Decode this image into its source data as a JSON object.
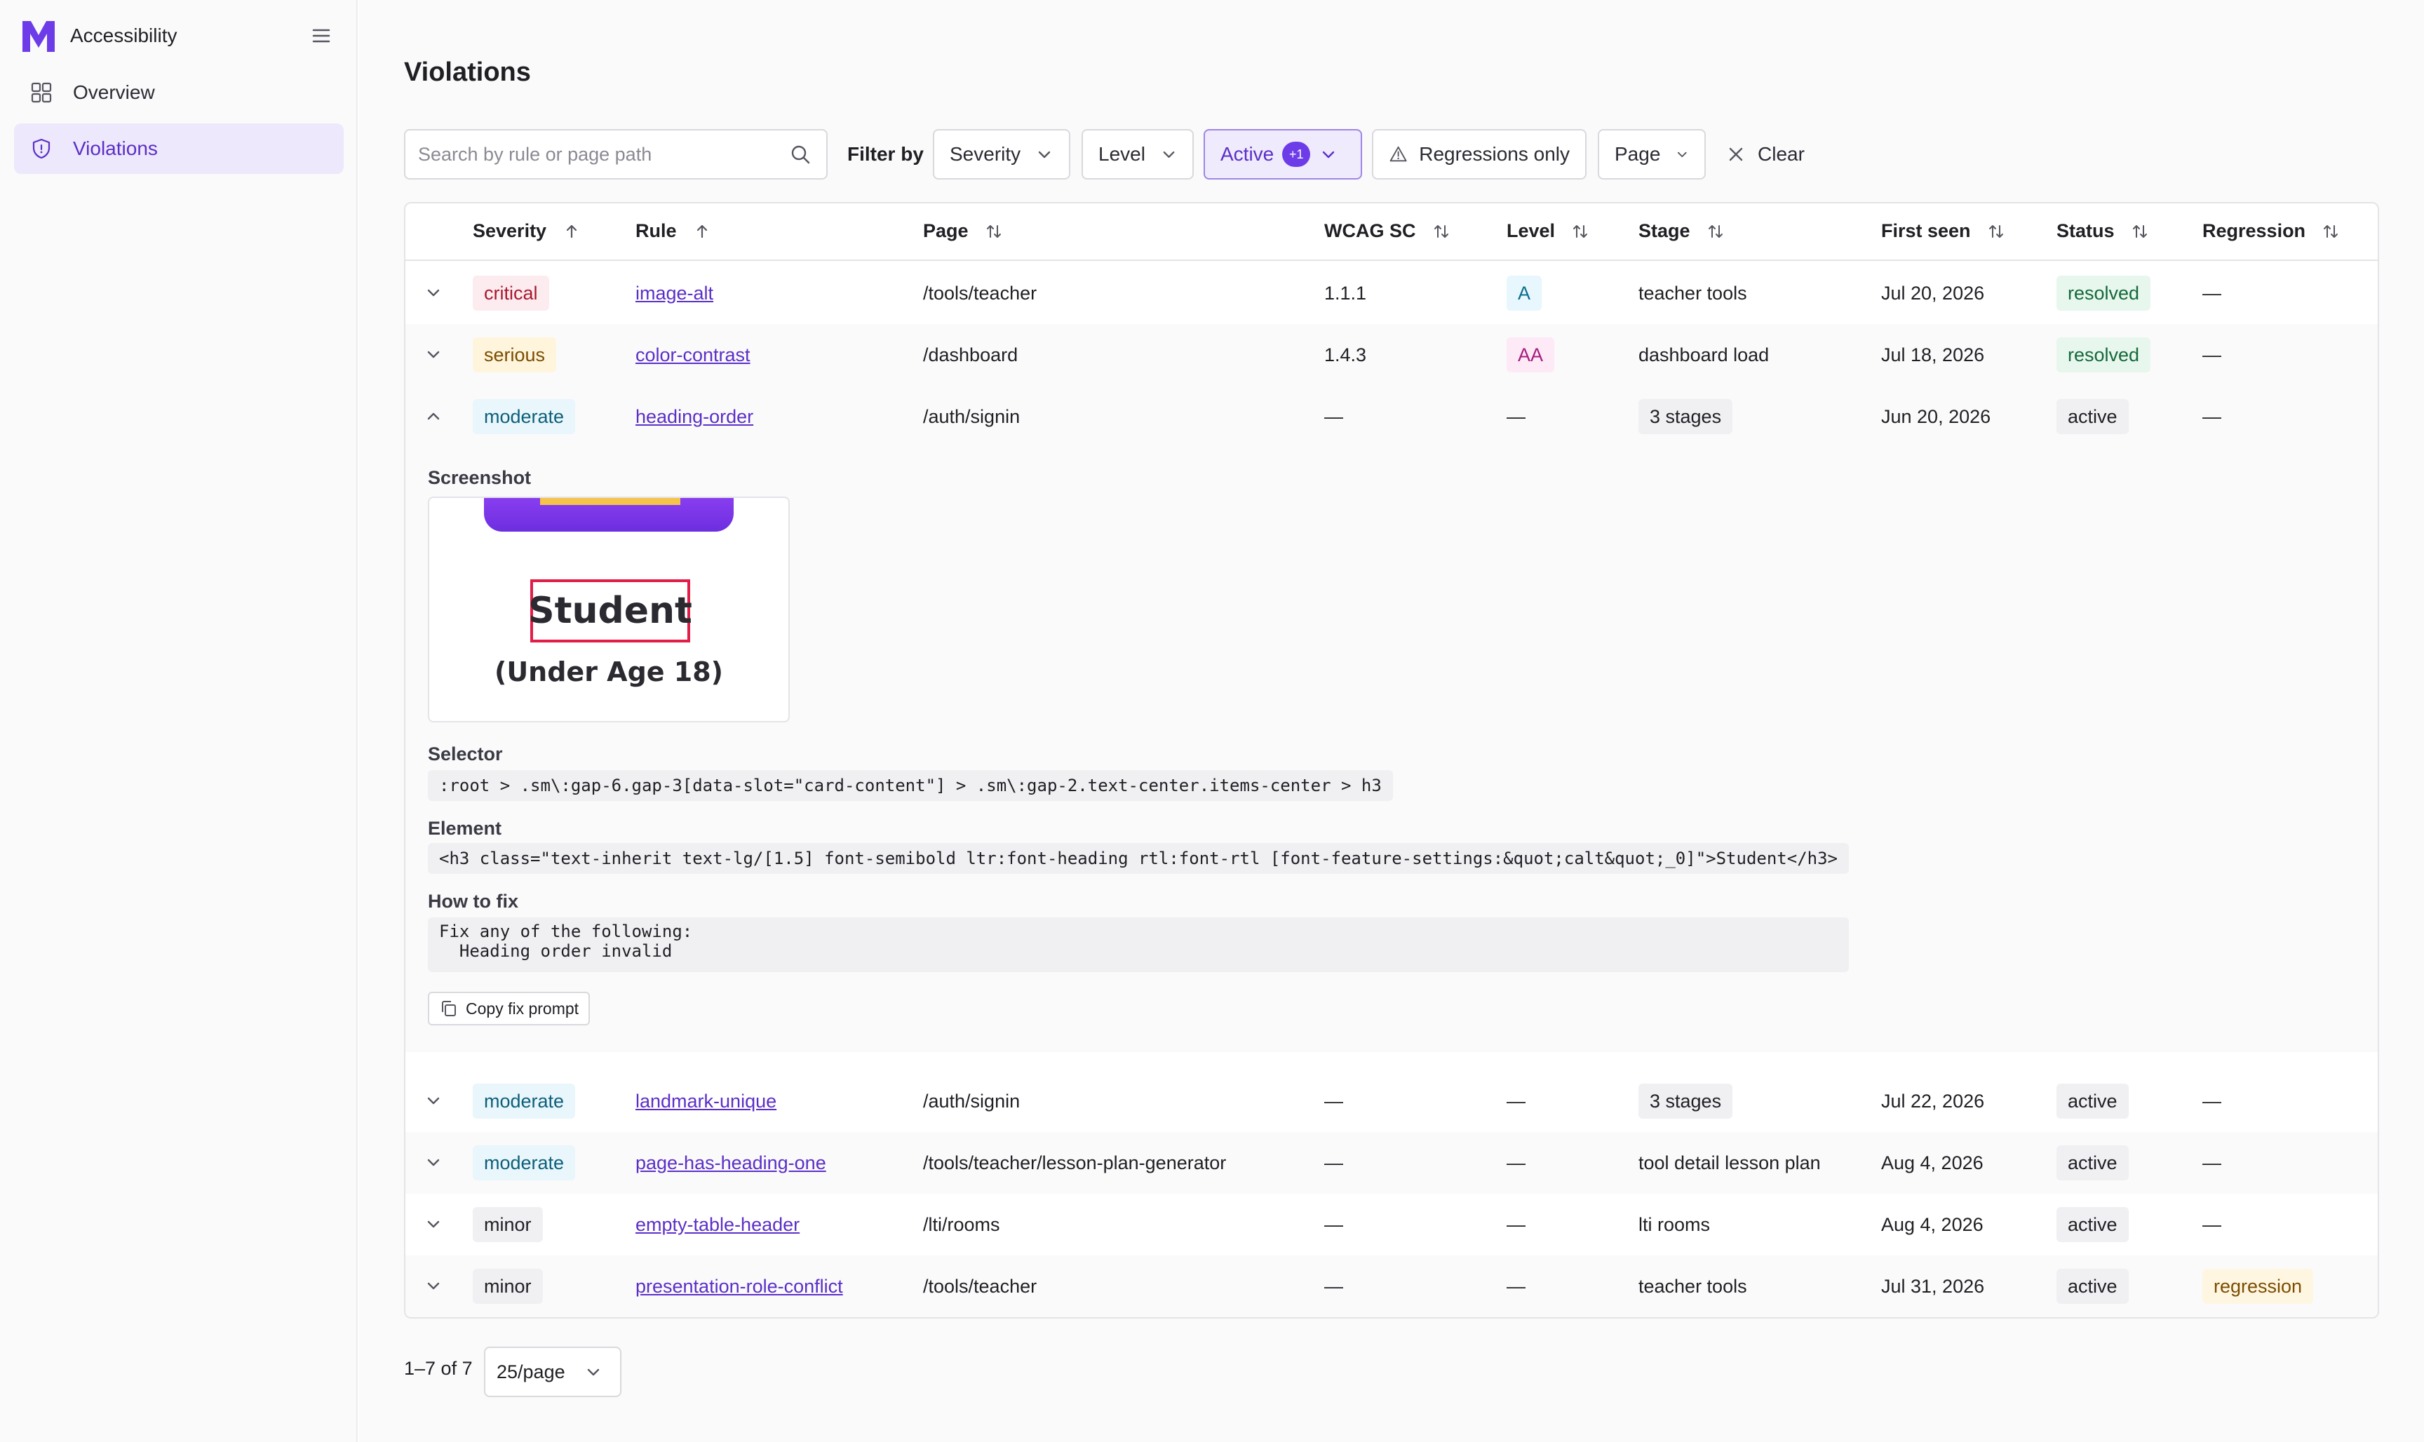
{
  "app": {
    "name": "Accessibility",
    "brand_letter": "M",
    "accent_color": "#6d3ce8"
  },
  "sidebar": {
    "items": [
      {
        "label": "Overview",
        "icon": "grid-icon",
        "active": false
      },
      {
        "label": "Violations",
        "icon": "shield-icon",
        "active": true
      }
    ]
  },
  "page": {
    "title": "Violations"
  },
  "toolbar": {
    "search_placeholder": "Search by rule or page path",
    "filter_by_label": "Filter by",
    "severity_label": "Severity",
    "level_label": "Level",
    "active_label": "Active",
    "active_count": "+1",
    "regressions_label": "Regressions only",
    "page_label": "Page",
    "clear_label": "Clear"
  },
  "table": {
    "columns": [
      "Severity",
      "Rule",
      "Page",
      "WCAG SC",
      "Level",
      "Stage",
      "First seen",
      "Status",
      "Regression"
    ],
    "rows": [
      {
        "severity": "critical",
        "rule": "image-alt",
        "page": "/tools/teacher",
        "wcag": "1.1.1",
        "level": "A",
        "stage": "teacher tools",
        "first_seen": "Jul 20, 2026",
        "status": "resolved",
        "regression": "—"
      },
      {
        "severity": "serious",
        "rule": "color-contrast",
        "page": "/dashboard",
        "wcag": "1.4.3",
        "level": "AA",
        "stage": "dashboard load",
        "first_seen": "Jul 18, 2026",
        "status": "resolved",
        "regression": "—"
      },
      {
        "severity": "moderate",
        "rule": "heading-order",
        "page": "/auth/signin",
        "wcag": "—",
        "level": "—",
        "stage": "3 stages",
        "first_seen": "Jun 20, 2026",
        "status": "active",
        "regression": "—"
      },
      {
        "severity": "moderate",
        "rule": "landmark-unique",
        "page": "/auth/signin",
        "wcag": "—",
        "level": "—",
        "stage": "3 stages",
        "first_seen": "Jul 22, 2026",
        "status": "active",
        "regression": "—"
      },
      {
        "severity": "moderate",
        "rule": "page-has-heading-one",
        "page": "/tools/teacher/lesson-plan-generator",
        "wcag": "—",
        "level": "—",
        "stage": "tool detail lesson plan",
        "first_seen": "Aug 4, 2026",
        "status": "active",
        "regression": "—"
      },
      {
        "severity": "minor",
        "rule": "empty-table-header",
        "page": "/lti/rooms",
        "wcag": "—",
        "level": "—",
        "stage": "lti rooms",
        "first_seen": "Aug 4, 2026",
        "status": "active",
        "regression": "—"
      },
      {
        "severity": "minor",
        "rule": "presentation-role-conflict",
        "page": "/tools/teacher",
        "wcag": "—",
        "level": "—",
        "stage": "teacher tools",
        "first_seen": "Jul 31, 2026",
        "status": "active",
        "regression": "regression"
      }
    ]
  },
  "details": {
    "screenshot_label": "Screenshot",
    "screenshot_title": "Student",
    "screenshot_subtitle": "(Under Age 18)",
    "selector_label": "Selector",
    "selector": ":root > .sm\\:gap-6.gap-3[data-slot=\"card-content\"] > .sm\\:gap-2.text-center.items-center > h3",
    "element_label": "Element",
    "element": "<h3 class=\"text-inherit text-lg/[1.5] font-semibold ltr:font-heading rtl:font-rtl [font-feature-settings:&quot;calt&quot;_0]\">Student</h3>",
    "how_to_fix_label": "How to fix",
    "how_to_fix": "Fix any of the following:\n  Heading order invalid",
    "copy_button": "Copy fix prompt"
  },
  "pagination": {
    "range": "1–7 of 7",
    "per_page": "25/page"
  }
}
